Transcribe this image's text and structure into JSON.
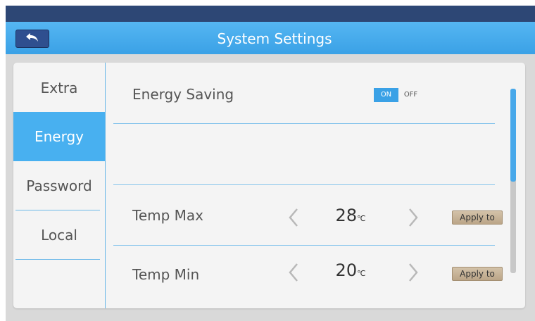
{
  "app": {
    "title": "System Settings"
  },
  "colors": {
    "accent": "#48b0f0",
    "header": "#3aa1e6",
    "frame": "#2d4775"
  },
  "sidebar": {
    "items": [
      {
        "label": "Extra",
        "active": false
      },
      {
        "label": "Energy",
        "active": true
      },
      {
        "label": "Password",
        "active": false
      },
      {
        "label": "Local",
        "active": false
      }
    ]
  },
  "settings": {
    "energy_saving": {
      "label": "Energy Saving",
      "on_label": "ON",
      "off_label": "OFF",
      "state": "ON"
    },
    "temp_max": {
      "label": "Temp Max",
      "value": "28",
      "unit": "℃",
      "apply_label": "Apply to"
    },
    "temp_min": {
      "label": "Temp Min",
      "value": "20",
      "unit": "℃",
      "apply_label": "Apply to"
    }
  },
  "icons": {
    "back": "back-arrow-icon",
    "decrease": "chevron-left-icon",
    "increase": "chevron-right-icon"
  }
}
